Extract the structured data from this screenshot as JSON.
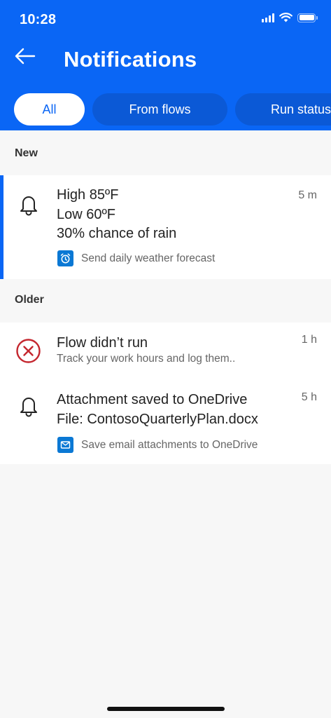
{
  "status_bar": {
    "time": "10:28"
  },
  "header": {
    "title": "Notifications"
  },
  "tabs": [
    {
      "label": "All",
      "active": true
    },
    {
      "label": "From flows",
      "active": false
    },
    {
      "label": "Run status",
      "active": false
    }
  ],
  "sections": {
    "new": {
      "label": "New",
      "items": [
        {
          "icon": "bell-icon",
          "lines": [
            "High 85ºF",
            "Low 60ºF",
            "30% chance of rain"
          ],
          "time": "5 m",
          "flow_icon": "alarm-clock-icon",
          "flow_name": "Send daily weather forecast"
        }
      ]
    },
    "older": {
      "label": "Older",
      "items": [
        {
          "icon": "error-circle-icon",
          "title": "Flow didn’t run",
          "subtitle": "Track your work hours and log them..",
          "time": "1 h"
        },
        {
          "icon": "bell-icon",
          "lines": [
            "Attachment saved to OneDrive",
            "File: ContosoQuarterlyPlan.docx"
          ],
          "time": "5 h",
          "flow_icon": "mail-icon",
          "flow_name": "Save email attachments to OneDrive"
        }
      ]
    }
  },
  "colors": {
    "brand_blue": "#0a66f5",
    "tab_inactive": "#0b59d6",
    "error_red": "#c4262e",
    "flow_chip": "#0a78d4"
  }
}
